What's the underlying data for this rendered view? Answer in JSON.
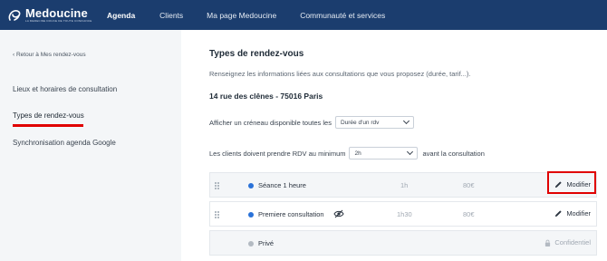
{
  "brand": {
    "name": "Medoucine",
    "tagline": "LA MEDECINE DOUCE DE TOUTE CONFIANCE"
  },
  "nav": {
    "items": [
      {
        "label": "Agenda",
        "active": true
      },
      {
        "label": "Clients",
        "active": false
      },
      {
        "label": "Ma page Medoucine",
        "active": false
      },
      {
        "label": "Communauté et services",
        "active": false
      }
    ]
  },
  "sidebar": {
    "back_label": "Retour à Mes rendez-vous",
    "items": [
      {
        "label": "Lieux et horaires de consultation",
        "active": false
      },
      {
        "label": "Types de rendez-vous",
        "active": true
      },
      {
        "label": "Synchronisation agenda Google",
        "active": false
      }
    ]
  },
  "main": {
    "title": "Types de rendez-vous",
    "intro": "Renseignez les informations liées aux consultations que vous proposez (durée, tarif...).",
    "address": "14 rue des clênes - 75016 Paris",
    "slot_row": {
      "label": "Afficher un créneau disponible toutes les",
      "select_value": "Durée d'un rdv"
    },
    "min_notice_row": {
      "label": "Les clients doivent prendre RDV au minimum",
      "select_value": "2h",
      "suffix": "avant la consultation"
    },
    "appointment_types": [
      {
        "name": "Séance 1 heure",
        "duration": "1h",
        "price": "80€",
        "action": "Modifier",
        "dot_color": "#2a72d8",
        "hidden": false,
        "highlighted": true
      },
      {
        "name": "Premiere consultation",
        "duration": "1h30",
        "price": "80€",
        "action": "Modifier",
        "dot_color": "#2a72d8",
        "hidden": true,
        "highlighted": false
      },
      {
        "name": "Privé",
        "duration": "",
        "price": "",
        "action": "Confidentiel",
        "dot_color": "#b3bac2",
        "hidden": false,
        "highlighted": false
      }
    ]
  },
  "colors": {
    "topbar": "#1b3d6e",
    "accent_dot": "#2a72d8",
    "annotation_red": "#e00000"
  }
}
